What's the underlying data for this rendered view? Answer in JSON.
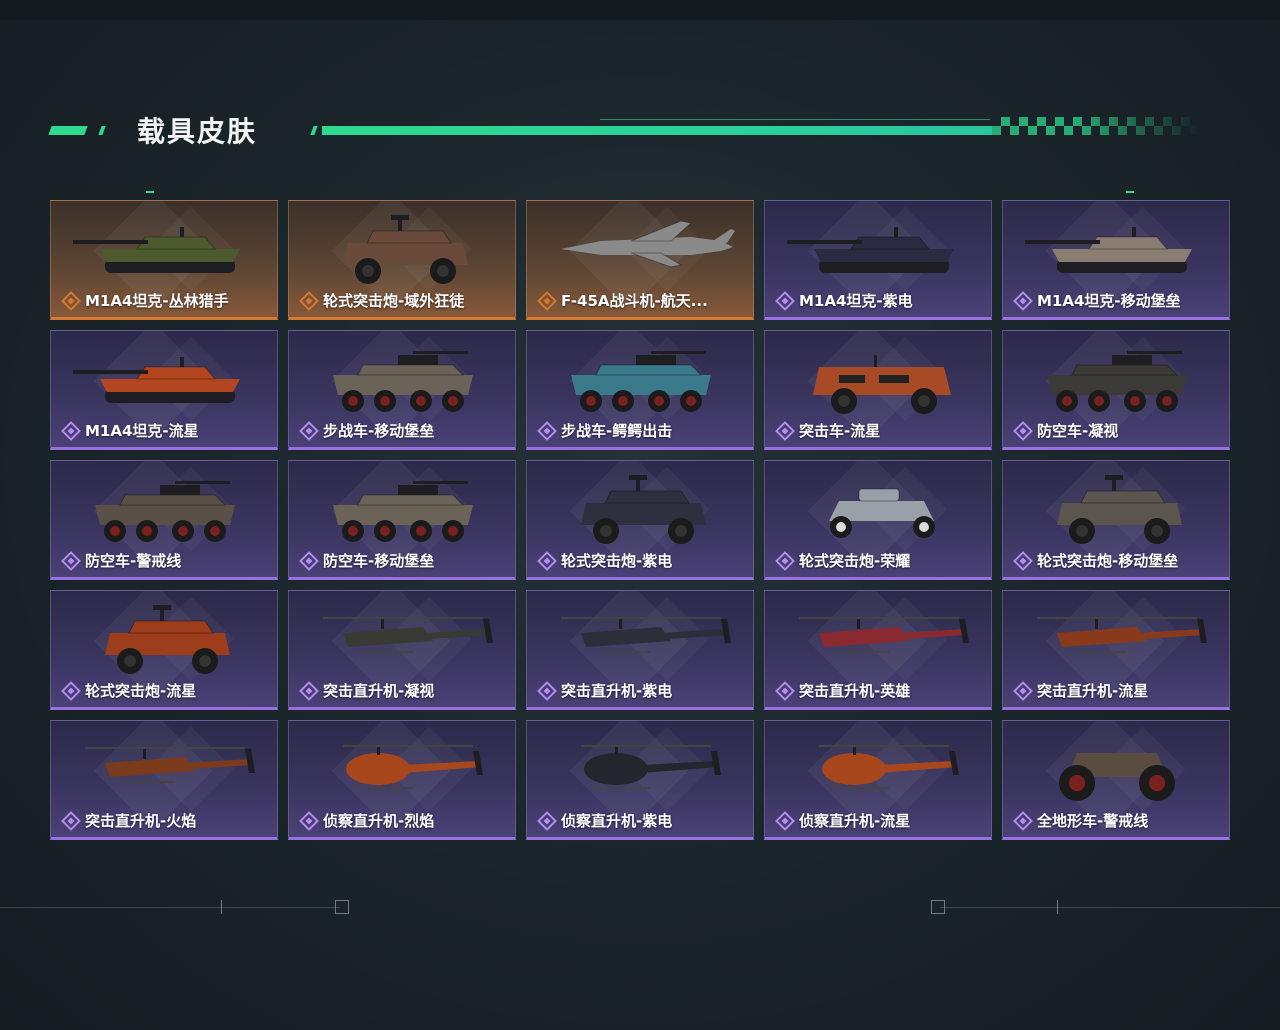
{
  "header": {
    "title": "载具皮肤"
  },
  "colors": {
    "accent": "#2fd98e",
    "rarity_orange": "#d7782f",
    "rarity_purple": "#9a6fe0"
  },
  "skins": [
    {
      "label": "M1A4坦克-丛林猎手",
      "rarity": "orange",
      "vehicle": "tank",
      "tint": "#4d5a2e"
    },
    {
      "label": "轮式突击炮-域外狂徒",
      "rarity": "orange",
      "vehicle": "wheeled-gun",
      "tint": "#6a4a3a"
    },
    {
      "label": "F-45A战斗机-航天...",
      "rarity": "orange",
      "vehicle": "jet",
      "tint": "#8a8a8a"
    },
    {
      "label": "M1A4坦克-紫电",
      "rarity": "purple",
      "vehicle": "tank",
      "tint": "#2a2a40"
    },
    {
      "label": "M1A4坦克-移动堡垒",
      "rarity": "purple",
      "vehicle": "tank",
      "tint": "#8a7e72"
    },
    {
      "label": "M1A4坦克-流星",
      "rarity": "purple",
      "vehicle": "tank",
      "tint": "#b3461e"
    },
    {
      "label": "步战车-移动堡垒",
      "rarity": "purple",
      "vehicle": "ifv",
      "tint": "#6b6258"
    },
    {
      "label": "步战车-鳄鳄出击",
      "rarity": "purple",
      "vehicle": "ifv",
      "tint": "#3a7a8a"
    },
    {
      "label": "突击车-流星",
      "rarity": "purple",
      "vehicle": "truck",
      "tint": "#a94a26"
    },
    {
      "label": "防空车-凝视",
      "rarity": "purple",
      "vehicle": "ifv",
      "tint": "#3c3a36"
    },
    {
      "label": "防空车-警戒线",
      "rarity": "purple",
      "vehicle": "ifv",
      "tint": "#5a5048"
    },
    {
      "label": "防空车-移动堡垒",
      "rarity": "purple",
      "vehicle": "ifv",
      "tint": "#6b6258"
    },
    {
      "label": "轮式突击炮-紫电",
      "rarity": "purple",
      "vehicle": "wheeled-gun",
      "tint": "#2e3040"
    },
    {
      "label": "轮式突击炮-荣耀",
      "rarity": "purple",
      "vehicle": "buggy",
      "tint": "#9aa0a8"
    },
    {
      "label": "轮式突击炮-移动堡垒",
      "rarity": "purple",
      "vehicle": "wheeled-gun",
      "tint": "#5b5550"
    },
    {
      "label": "轮式突击炮-流星",
      "rarity": "purple",
      "vehicle": "wheeled-gun",
      "tint": "#9e3d1c"
    },
    {
      "label": "突击直升机-凝视",
      "rarity": "purple",
      "vehicle": "attack-heli",
      "tint": "#3a3a34"
    },
    {
      "label": "突击直升机-紫电",
      "rarity": "purple",
      "vehicle": "attack-heli",
      "tint": "#2c2e3a"
    },
    {
      "label": "突击直升机-英雄",
      "rarity": "purple",
      "vehicle": "attack-heli",
      "tint": "#8a2a30"
    },
    {
      "label": "突击直升机-流星",
      "rarity": "purple",
      "vehicle": "attack-heli",
      "tint": "#8a3a1c"
    },
    {
      "label": "突击直升机-火焰",
      "rarity": "purple",
      "vehicle": "attack-heli",
      "tint": "#7a3a1c"
    },
    {
      "label": "侦察直升机-烈焰",
      "rarity": "purple",
      "vehicle": "scout-heli",
      "tint": "#a8461c"
    },
    {
      "label": "侦察直升机-紫电",
      "rarity": "purple",
      "vehicle": "scout-heli",
      "tint": "#24262e"
    },
    {
      "label": "侦察直升机-流星",
      "rarity": "purple",
      "vehicle": "scout-heli",
      "tint": "#a8461c"
    },
    {
      "label": "全地形车-警戒线",
      "rarity": "purple",
      "vehicle": "atv",
      "tint": "#5a4c40"
    }
  ]
}
